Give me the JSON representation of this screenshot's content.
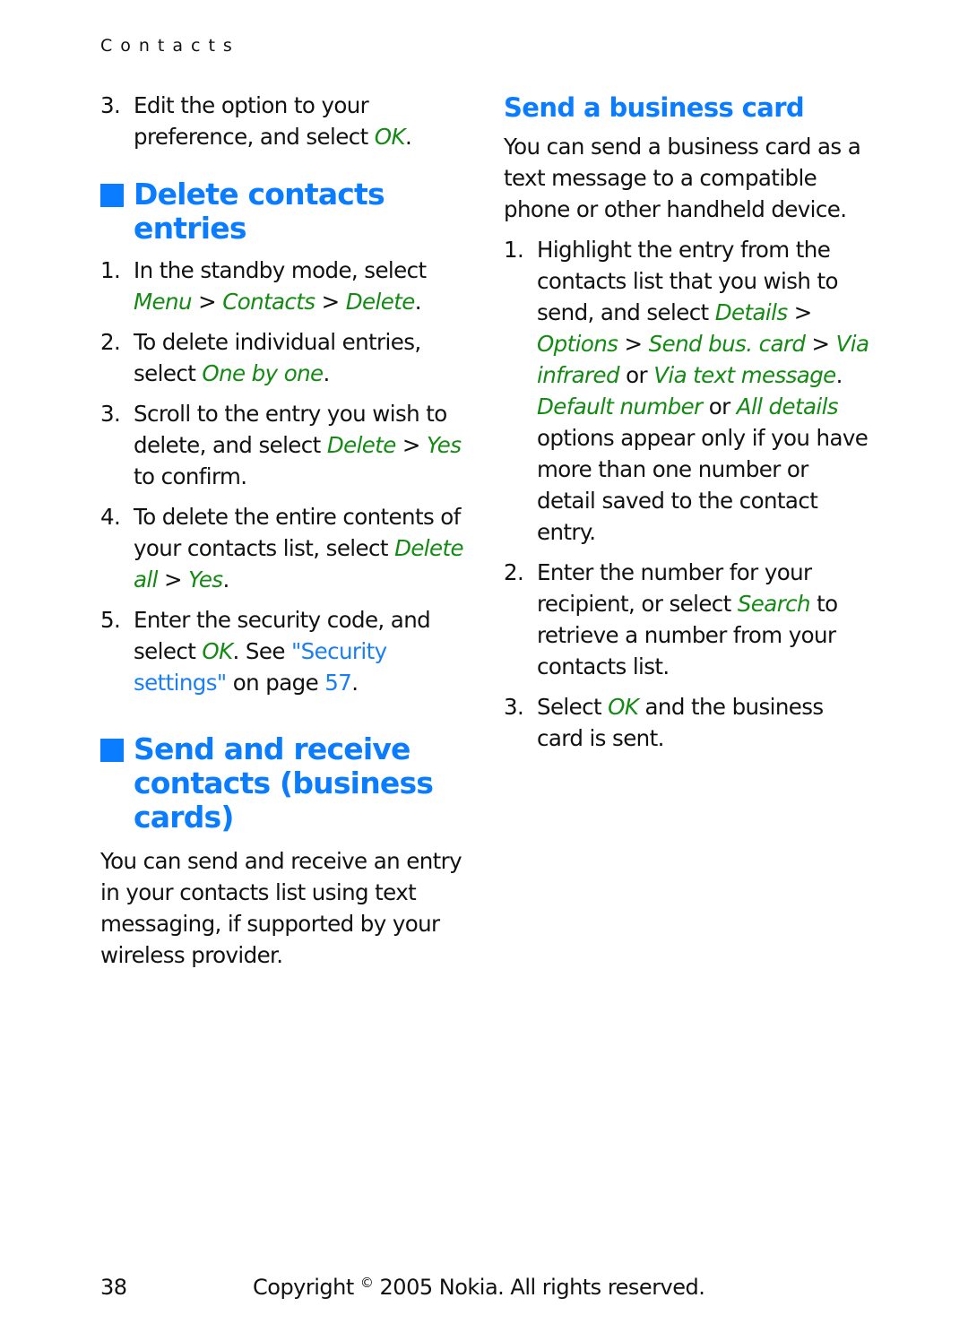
{
  "running_head": "Contacts",
  "left_column": {
    "continued_step": {
      "number": "3.",
      "parts": [
        "Edit the option to your preference, and select ",
        "OK",
        "."
      ]
    },
    "delete_section": {
      "title": "Delete contacts entries",
      "steps": [
        {
          "number": "1.",
          "t1": "In the standby mode, select ",
          "g1": "Menu",
          "t2": " > ",
          "g2": "Contacts",
          "t3": " > ",
          "g3": "Delete",
          "t4": "."
        },
        {
          "number": "2.",
          "t1": "To delete individual entries, select ",
          "g1": "One by one",
          "t2": "."
        },
        {
          "number": "3.",
          "t1": "Scroll to the entry you wish to delete, and select ",
          "g1": "Delete",
          "t2": " > ",
          "g2": "Yes",
          "t3": " to confirm."
        },
        {
          "number": "4.",
          "t1": "To delete the entire contents of your contacts list, select ",
          "g1": "Delete all",
          "t2": " > ",
          "g2": "Yes",
          "t3": "."
        },
        {
          "number": "5.",
          "t1": "Enter the security code, and select ",
          "g1": "OK",
          "t2": ". See ",
          "link": "\"Security settings\"",
          "t3": " on page ",
          "page_link": "57",
          "t4": "."
        }
      ]
    },
    "send_receive_section": {
      "title": "Send and receive contacts (business cards)",
      "paragraph": "You can send and receive an entry in your contacts list using text messaging, if supported by your wireless provider."
    }
  },
  "right_column": {
    "send_card_section": {
      "title": "Send a business card",
      "intro": "You can send a business card as a text message to a compatible phone or other handheld device.",
      "steps": [
        {
          "number": "1.",
          "t1": "Highlight the entry from the contacts list that you wish to send, and select ",
          "g1": "Details",
          "t2": " > ",
          "g2": "Options",
          "t3": " > ",
          "g3": "Send bus. card",
          "t4": " > ",
          "g4": "Via infrared",
          "t5": " or ",
          "g5": "Via text message",
          "t6": ". ",
          "g6": "Default number",
          "t7": " or ",
          "g7": "All details",
          "t8": " options appear only if you have more than one number or detail saved to the contact entry."
        },
        {
          "number": "2.",
          "t1": "Enter the number for your recipient, or select ",
          "g1": "Search",
          "t2": " to retrieve a number from your contacts list."
        },
        {
          "number": "3.",
          "t1": "Select ",
          "g1": "OK",
          "t2": " and the business card is sent."
        }
      ]
    }
  },
  "footer": {
    "page_number": "38",
    "copyright_pre": "Copyright ",
    "copyright_symbol": "©",
    "copyright_post": " 2005 Nokia. All rights reserved."
  },
  "colors": {
    "heading_blue": "#0a7cff",
    "menu_green": "#138a13",
    "link_blue": "#1a7ef5"
  }
}
